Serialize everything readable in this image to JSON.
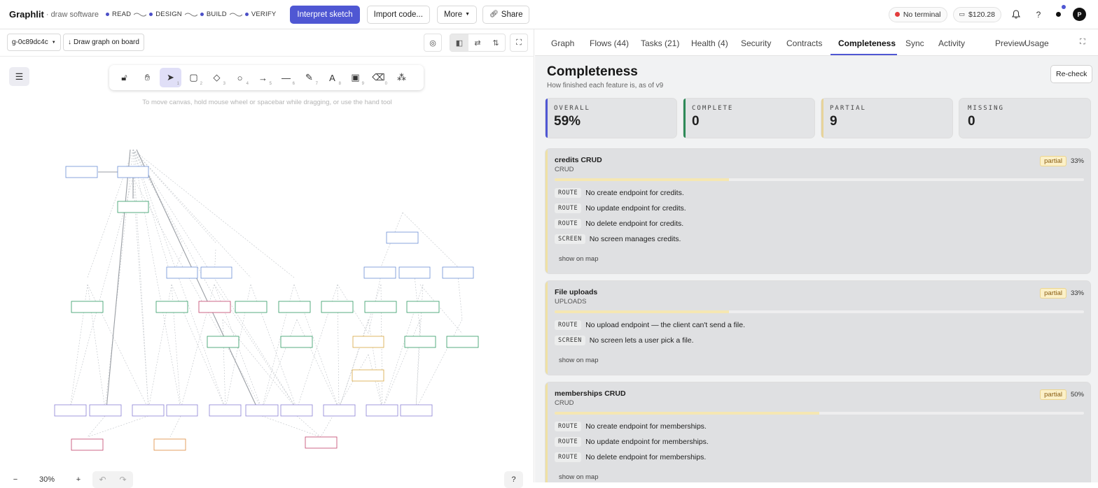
{
  "app": {
    "name": "Graphlit",
    "subtitle": "· draw software"
  },
  "steps": [
    "READ",
    "DESIGN",
    "BUILD",
    "VERIFY"
  ],
  "header": {
    "interpret_label": "Interpret sketch",
    "import_label": "Import code...",
    "more_label": "More",
    "share_label": "Share",
    "terminal_label": "No terminal",
    "balance": "$120.28",
    "help": "?",
    "avatar": "P"
  },
  "board": {
    "graph_id": "g-0c89dc4c",
    "draw_label": "Draw graph on board",
    "hint": "To move canvas, hold mouse wheel or spacebar while dragging, or use the hand tool",
    "zoom": "30%",
    "help": "?"
  },
  "tabs": [
    "Graph",
    "Flows (44)",
    "Tasks (21)",
    "Health (4)",
    "Security",
    "Contracts",
    "Completeness",
    "Sync",
    "Activity",
    "Preview",
    "Usage"
  ],
  "active_tab": "Completeness",
  "panel": {
    "title": "Completeness",
    "subtitle": "How finished each feature is, as of v9",
    "recheck_label": "Re-check"
  },
  "stats": [
    {
      "label": "OVERALL",
      "value": "59%",
      "color": "#4f57d3"
    },
    {
      "label": "COMPLETE",
      "value": "0",
      "color": "#2e8a58"
    },
    {
      "label": "PARTIAL",
      "value": "9",
      "color": "#e7d39a"
    },
    {
      "label": "MISSING",
      "value": "0",
      "color": "#dcdcdc"
    }
  ],
  "features": [
    {
      "title": "credits CRUD",
      "type": "CRUD",
      "status": "partial",
      "percent_label": "33%",
      "progress": 0.33,
      "issues": [
        {
          "kind": "ROUTE",
          "text": "No create endpoint for credits."
        },
        {
          "kind": "ROUTE",
          "text": "No update endpoint for credits."
        },
        {
          "kind": "ROUTE",
          "text": "No delete endpoint for credits."
        },
        {
          "kind": "SCREEN",
          "text": "No screen manages credits."
        }
      ],
      "show_label": "show on map"
    },
    {
      "title": "File uploads",
      "type": "UPLOADS",
      "status": "partial",
      "percent_label": "33%",
      "progress": 0.33,
      "issues": [
        {
          "kind": "ROUTE",
          "text": "No upload endpoint — the client can't send a file."
        },
        {
          "kind": "SCREEN",
          "text": "No screen lets a user pick a file."
        }
      ],
      "show_label": "show on map"
    },
    {
      "title": "memberships CRUD",
      "type": "CRUD",
      "status": "partial",
      "percent_label": "50%",
      "progress": 0.5,
      "issues": [
        {
          "kind": "ROUTE",
          "text": "No create endpoint for memberships."
        },
        {
          "kind": "ROUTE",
          "text": "No update endpoint for memberships."
        },
        {
          "kind": "ROUTE",
          "text": "No delete endpoint for memberships."
        }
      ],
      "show_label": "show on map"
    }
  ]
}
